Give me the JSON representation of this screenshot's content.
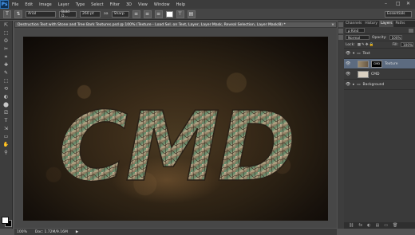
{
  "menubar": {
    "logo": "Ps",
    "items": [
      "File",
      "Edit",
      "Image",
      "Layer",
      "Type",
      "Select",
      "Filter",
      "3D",
      "View",
      "Window",
      "Help"
    ],
    "window_controls": [
      "–",
      "□",
      "✕"
    ]
  },
  "options": {
    "tool_glyph": "T",
    "font_family": "Arial",
    "font_style": "Bold D...",
    "font_size": "260 pt",
    "aa_prefix": "aa",
    "anti_alias": "Sharp",
    "warp_glyph": "⊤",
    "panels_glyph": "▤",
    "essentials": "Essentials"
  },
  "toolbar": {
    "tools": [
      "⇱",
      "⬚",
      "ʘ",
      "✂",
      "⌗",
      "✚",
      "✎",
      "⬚",
      "⟲",
      "◐",
      "⬤",
      "⎚",
      "T",
      "⇲",
      "▭",
      "✋",
      "⚲"
    ]
  },
  "document": {
    "tab_title": "Destruction Text with Stone and Tree Bark Textures.psd @ 100% (Texture - Load Sel. on Text, Layer, Layer Mask, Reveal Selection, Layer Mask/8) *",
    "close": "×",
    "artwork_text": "CMD"
  },
  "status": {
    "zoom": "100%",
    "doc_info": "Doc: 1.72M/9.16M",
    "arrow": "▶"
  },
  "panel": {
    "tabs": [
      "Channels",
      "History",
      "Layers",
      "Paths"
    ],
    "filter_label": "ρ Kind",
    "blend_mode": "Normal",
    "opacity_label": "Opacity:",
    "opacity_value": "100%",
    "lock_label": "Lock:",
    "fill_label": "Fill:",
    "fill_value": "100%",
    "layers": [
      {
        "name": "Text",
        "type": "group"
      },
      {
        "name": "Texture",
        "type": "layer",
        "selected": true
      },
      {
        "name": "CMD",
        "type": "text"
      },
      {
        "name": "Background",
        "type": "group"
      }
    ],
    "bottom_icons": [
      "⛓",
      "fx",
      "◐",
      "▤",
      "▭",
      "🗑"
    ]
  },
  "colors": {
    "selected_layer": "#5c6b80",
    "ps_blue": "#4fa3ff"
  }
}
